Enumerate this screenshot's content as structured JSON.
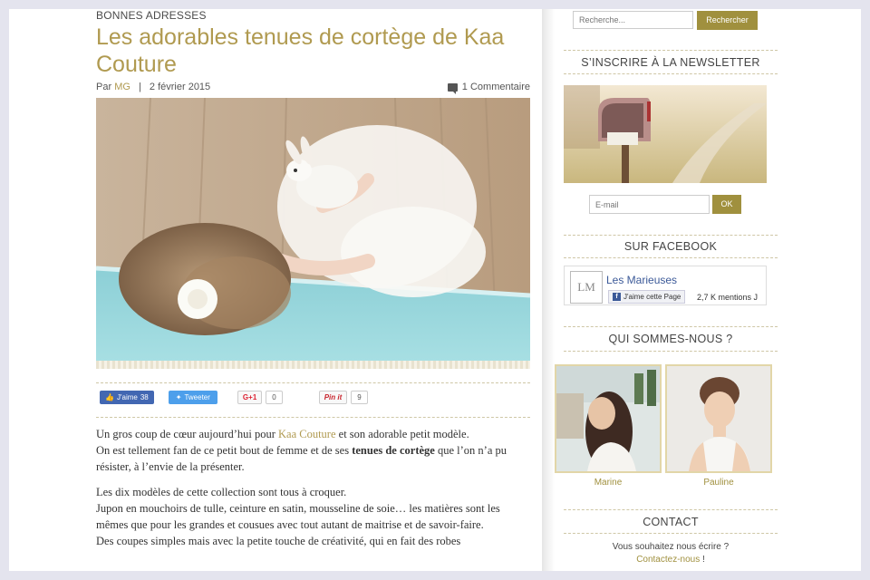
{
  "article": {
    "category": "BONNES ADRESSES",
    "title": "Les adorables tenues de cortège de Kaa Couture",
    "meta": {
      "by": "Par",
      "author": "MG",
      "separator": "|",
      "date": "2 février 2015",
      "comments": "1 Commentaire"
    },
    "share": {
      "facebook_label": "J'aime",
      "facebook_count": "38",
      "twitter_label": "Tweeter",
      "gplus_label": "G+1",
      "gplus_count": "0",
      "pinterest_label": "Pin it",
      "pinterest_count": "9"
    },
    "paragraphs": {
      "p1_a": "Un gros coup de cœur aujourd’hui pour ",
      "p1_link": "Kaa Couture",
      "p1_b": " et son adorable petit modèle.",
      "p2_a": "On est tellement fan de ce petit bout de femme et de ses ",
      "p2_bold": "tenues de cortège",
      "p2_b": " que l’on n’a pu résister, à l’envie de la présenter.",
      "p3": "Les dix modèles de cette collection sont tous à croquer.",
      "p4": "Jupon en mouchoirs de tulle, ceinture en satin,  mousseline de soie… les matières sont les mêmes que pour les grandes et cousues avec tout autant de maitrise et de savoir-faire.",
      "p5": "Des coupes simples mais avec la petite touche de créativité, qui en fait des robes"
    }
  },
  "sidebar": {
    "search": {
      "placeholder": "Recherche...",
      "button": "Rechercher"
    },
    "newsletter": {
      "title": "S’INSCRIRE À LA NEWSLETTER",
      "email_placeholder": "E-mail",
      "button": "OK"
    },
    "facebook": {
      "title": "SUR FACEBOOK",
      "page_name": "Les Marieuses",
      "logo_text": "LM",
      "like_label": "J'aime cette Page",
      "like_count": "2,7 K mentions J"
    },
    "about": {
      "title": "QUI SOMMES-NOUS ?",
      "members": [
        {
          "name": "Marine"
        },
        {
          "name": "Pauline"
        }
      ]
    },
    "contact": {
      "title": "CONTACT",
      "line1": "Vous souhaitez nous écrire ?",
      "link": "Contactez-nous",
      "link_suffix": " !"
    }
  },
  "colors": {
    "accent": "#b09a50",
    "button": "#a0903e",
    "facebook": "#4267b2",
    "twitter": "#4d9feb"
  }
}
